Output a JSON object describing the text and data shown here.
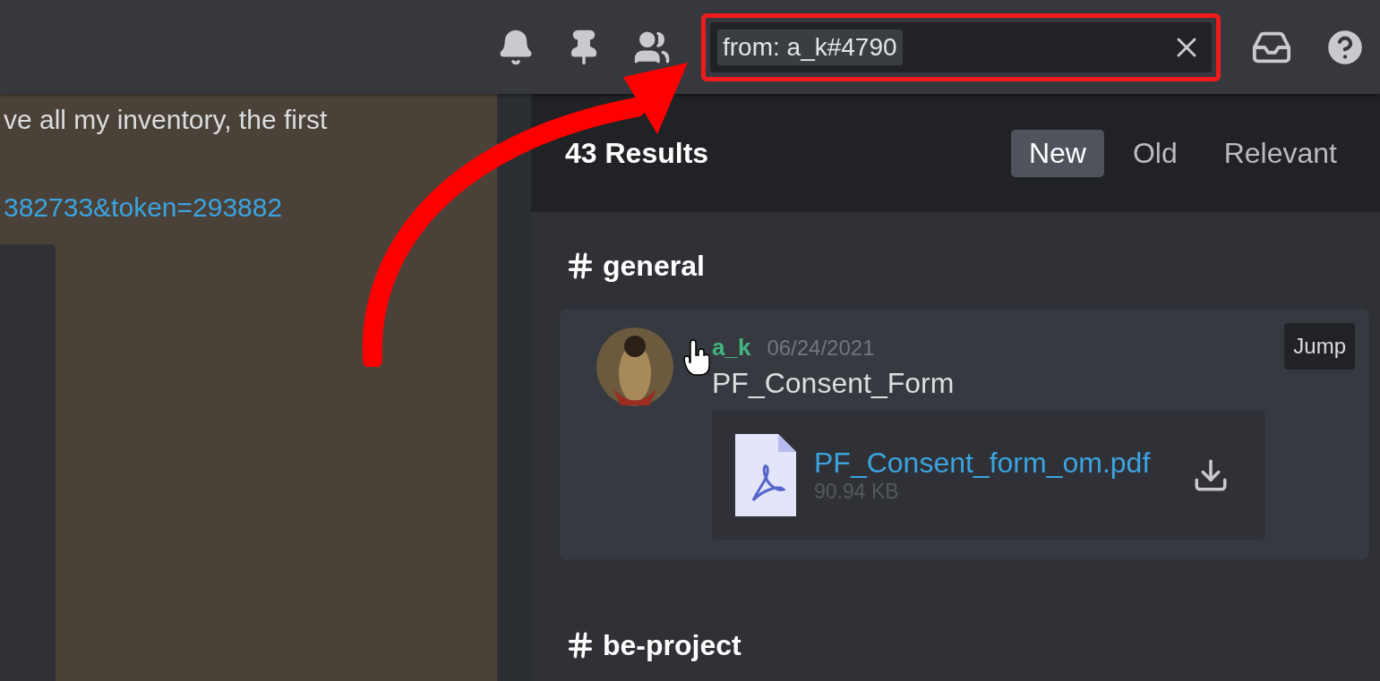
{
  "toolbar": {
    "search": {
      "value": "from: a_k#4790",
      "highlighted": true
    }
  },
  "chat": {
    "lines": [
      {
        "kind": "text",
        "text": "ve all my inventory, the first"
      },
      {
        "kind": "link",
        "text": "382733&token=293882"
      }
    ]
  },
  "search_results": {
    "count": "43 Results",
    "sort_tabs": [
      {
        "label": "New",
        "selected": true
      },
      {
        "label": "Old",
        "selected": false
      },
      {
        "label": "Relevant",
        "selected": false
      }
    ],
    "groups": [
      {
        "channel": "general",
        "results": [
          {
            "author": "a_k",
            "date": "06/24/2021",
            "message": "PF_Consent_Form",
            "jump": "Jump",
            "attachment": {
              "name": "PF_Consent_form_om.pdf",
              "size": "90.94 KB"
            }
          }
        ]
      },
      {
        "channel": "be-project"
      }
    ]
  },
  "annotation": {
    "kind": "arrow"
  }
}
